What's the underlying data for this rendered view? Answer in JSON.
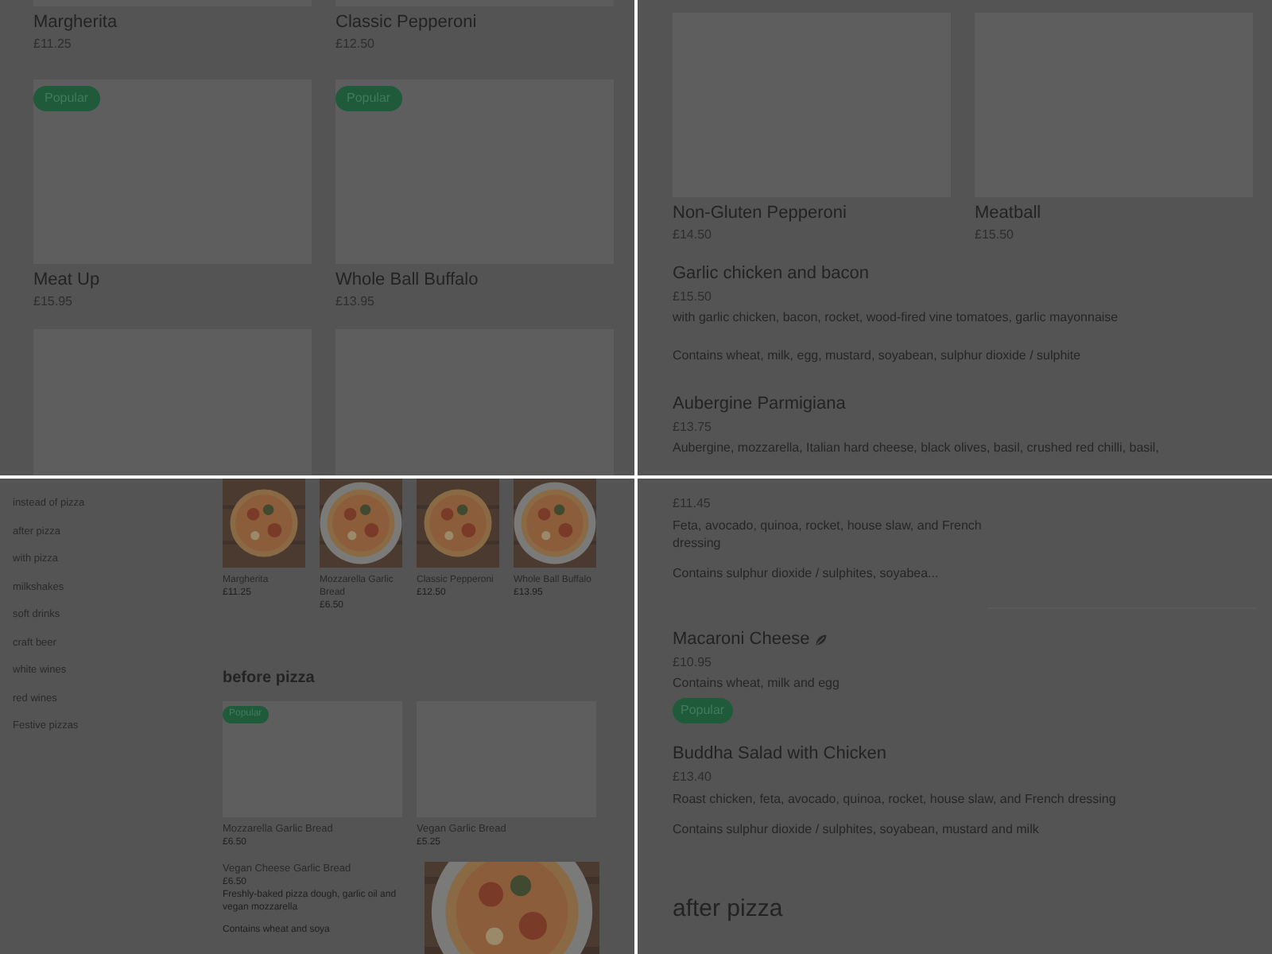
{
  "top_left": {
    "cards": [
      {
        "name": "Margherita",
        "price": "£11.25"
      },
      {
        "name": "Classic Pepperoni",
        "price": "£12.50"
      },
      {
        "name": "Meat Up",
        "price": "£15.95",
        "popular": true,
        "badge": "Popular"
      },
      {
        "name": "Whole Ball Buffalo",
        "price": "£13.95",
        "popular": true,
        "badge": "Popular"
      }
    ]
  },
  "top_right": {
    "cards": [
      {
        "name": "Non-Gluten Pepperoni",
        "price": "£14.50"
      },
      {
        "name": "Meatball",
        "price": "£15.50"
      }
    ],
    "items": [
      {
        "name": "Garlic chicken and bacon",
        "price": "£15.50",
        "description": "with garlic chicken, bacon, rocket, wood-fired vine tomatoes, garlic mayonnaise",
        "allergens": "Contains wheat, milk, egg, mustard, soyabean, sulphur dioxide / sulphite"
      },
      {
        "name": "Aubergine Parmigiana",
        "price": "£13.75",
        "description": "Aubergine, mozzarella, Italian hard cheese, black olives, basil, crushed red chilli, basil,"
      }
    ]
  },
  "bottom_left": {
    "sidebar": [
      {
        "label": "instead of pizza"
      },
      {
        "label": "after pizza"
      },
      {
        "label": "with pizza"
      },
      {
        "label": "milkshakes"
      },
      {
        "label": "soft drinks"
      },
      {
        "label": "craft beer"
      },
      {
        "label": "white wines"
      },
      {
        "label": "red wines"
      },
      {
        "label": "Festive pizzas"
      }
    ],
    "featured": [
      {
        "name": "Margherita",
        "price": "£11.25"
      },
      {
        "name": "Mozzarella Garlic Bread",
        "price": "£6.50"
      },
      {
        "name": "Classic Pepperoni",
        "price": "£12.50"
      },
      {
        "name": "Whole Ball Buffalo",
        "price": "£13.95"
      }
    ],
    "section": {
      "title": "before pizza",
      "cards": [
        {
          "name": "Mozzarella Garlic Bread",
          "price": "£6.50",
          "popular": true,
          "badge": "Popular"
        },
        {
          "name": "Vegan Garlic Bread",
          "price": "£5.25",
          "popular": false
        }
      ],
      "item": {
        "name": "Vegan Cheese Garlic Bread",
        "price": "£6.50",
        "description": "Freshly-baked pizza dough, garlic oil and vegan mozzarella",
        "allergens": "Contains wheat and soya"
      }
    }
  },
  "bottom_right": {
    "items": [
      {
        "price": "£11.45",
        "description": "Feta, avocado, quinoa, rocket, house slaw, and French dressing",
        "allergens": "Contains sulphur dioxide / sulphites, soyabea...",
        "popular": false
      },
      {
        "name": "Macaroni Cheese",
        "price": "£10.95",
        "allergens": "Contains wheat, milk and egg",
        "vegetarian": true,
        "popular": true,
        "badge": "Popular"
      },
      {
        "name": "Buddha Salad with Chicken",
        "price": "£13.40",
        "description": "Roast chicken, feta, avocado, quinoa, rocket, house slaw, and French dressing",
        "allergens": "Contains sulphur dioxide / sulphites, soyabean, mustard and milk",
        "vegetarian": false,
        "popular": false
      }
    ],
    "next_section": "after pizza"
  }
}
